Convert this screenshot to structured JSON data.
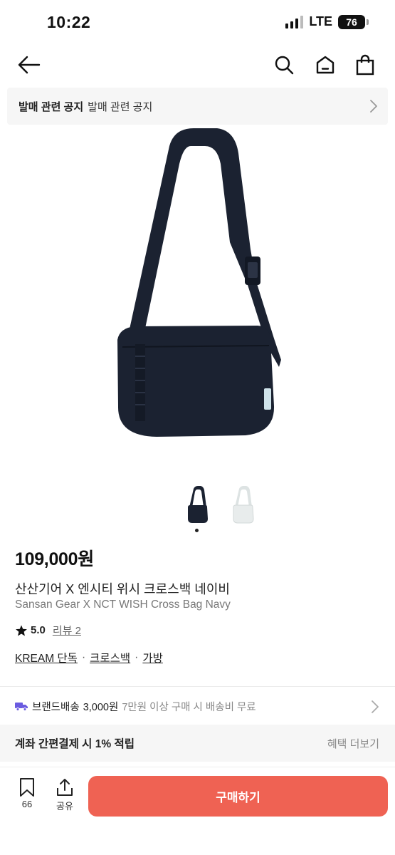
{
  "status_bar": {
    "time": "10:22",
    "network": "LTE",
    "battery": "76"
  },
  "nav": {
    "icons": [
      "back-arrow-icon",
      "search-icon",
      "home-icon",
      "shopping-bag-icon"
    ]
  },
  "notice": {
    "title": "발매 관련 공지",
    "text": "발매 관련 공지"
  },
  "product": {
    "price": "109,000원",
    "name_ko": "산산기어 X 엔시티 위시 크로스백 네이비",
    "name_en": "Sansan Gear X NCT WISH Cross Bag Navy",
    "rating": "5.0",
    "review_label": "리뷰 2",
    "tags": [
      "KREAM 단독",
      "크로스백",
      "가방"
    ],
    "tag_separator": "·",
    "colors": {
      "navy": "#1b2231",
      "light": "#e8ecec"
    }
  },
  "shipping": {
    "label": "브랜드배송",
    "price": "3,000원",
    "description": "7만원 이상 구매 시 배송비 무료"
  },
  "benefit": {
    "text": "계좌 간편결제 시 1% 적립",
    "more": "혜택 더보기"
  },
  "bottom_bar": {
    "save_count": "66",
    "share_label": "공유",
    "buy_label": "구매하기",
    "buy_color": "#ef6253"
  }
}
